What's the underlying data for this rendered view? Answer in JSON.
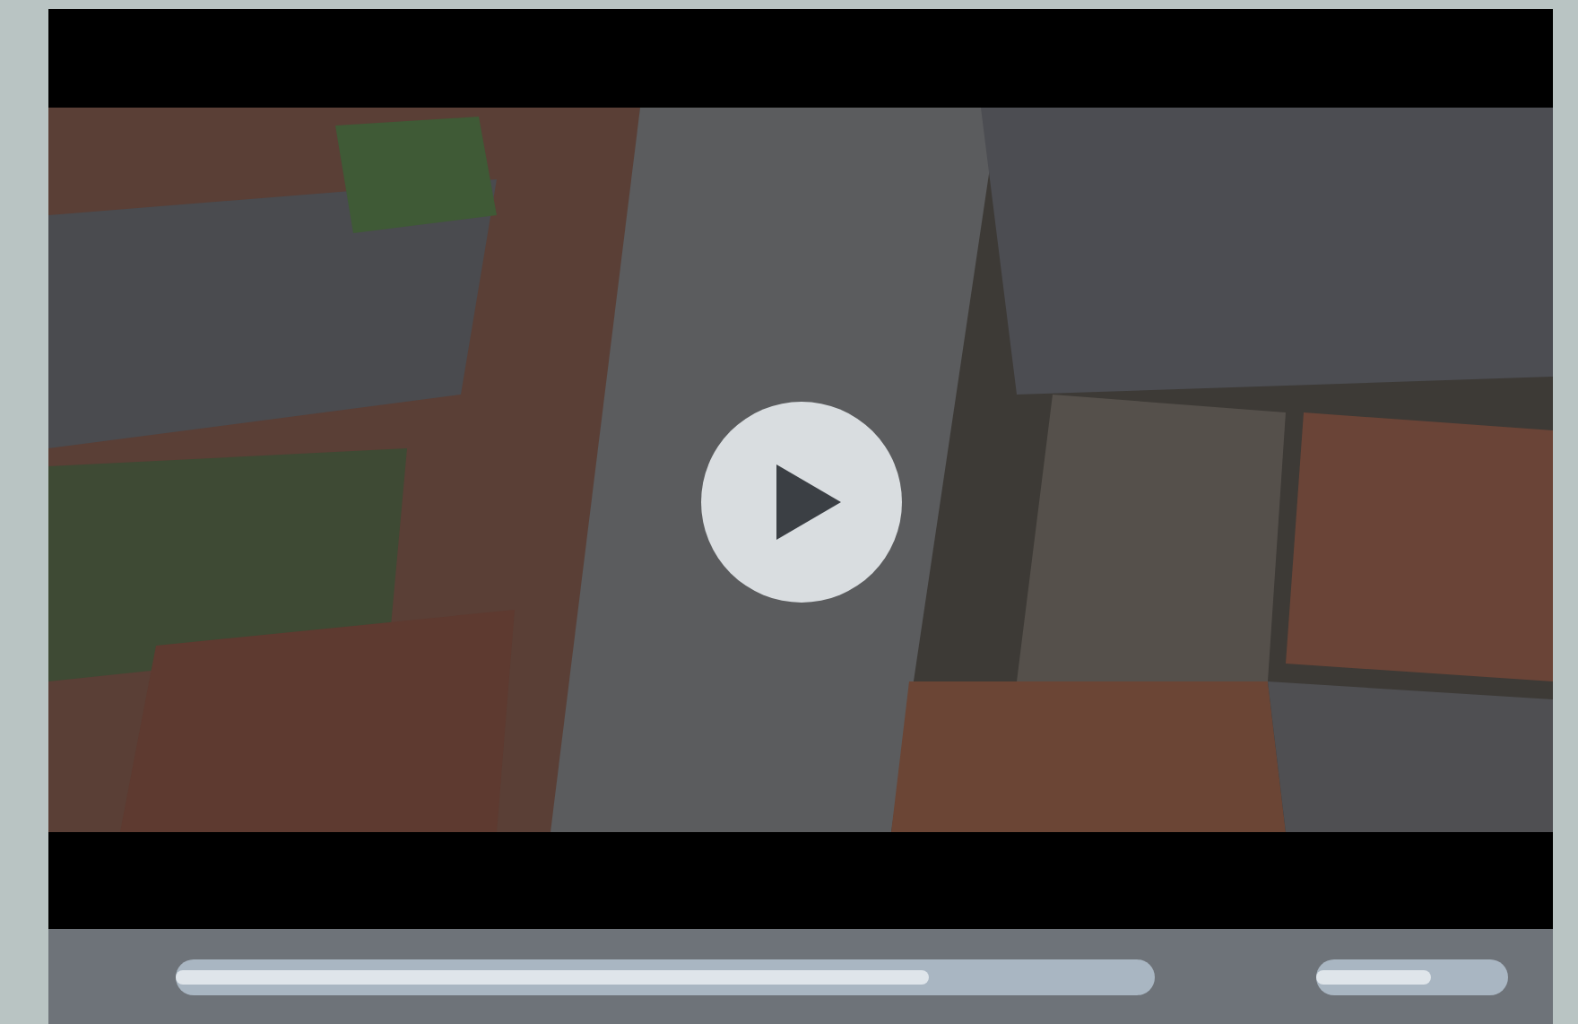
{
  "player": {
    "playing": false,
    "progress": {
      "level": 0.77
    },
    "volume": {
      "level": 0.6
    }
  }
}
